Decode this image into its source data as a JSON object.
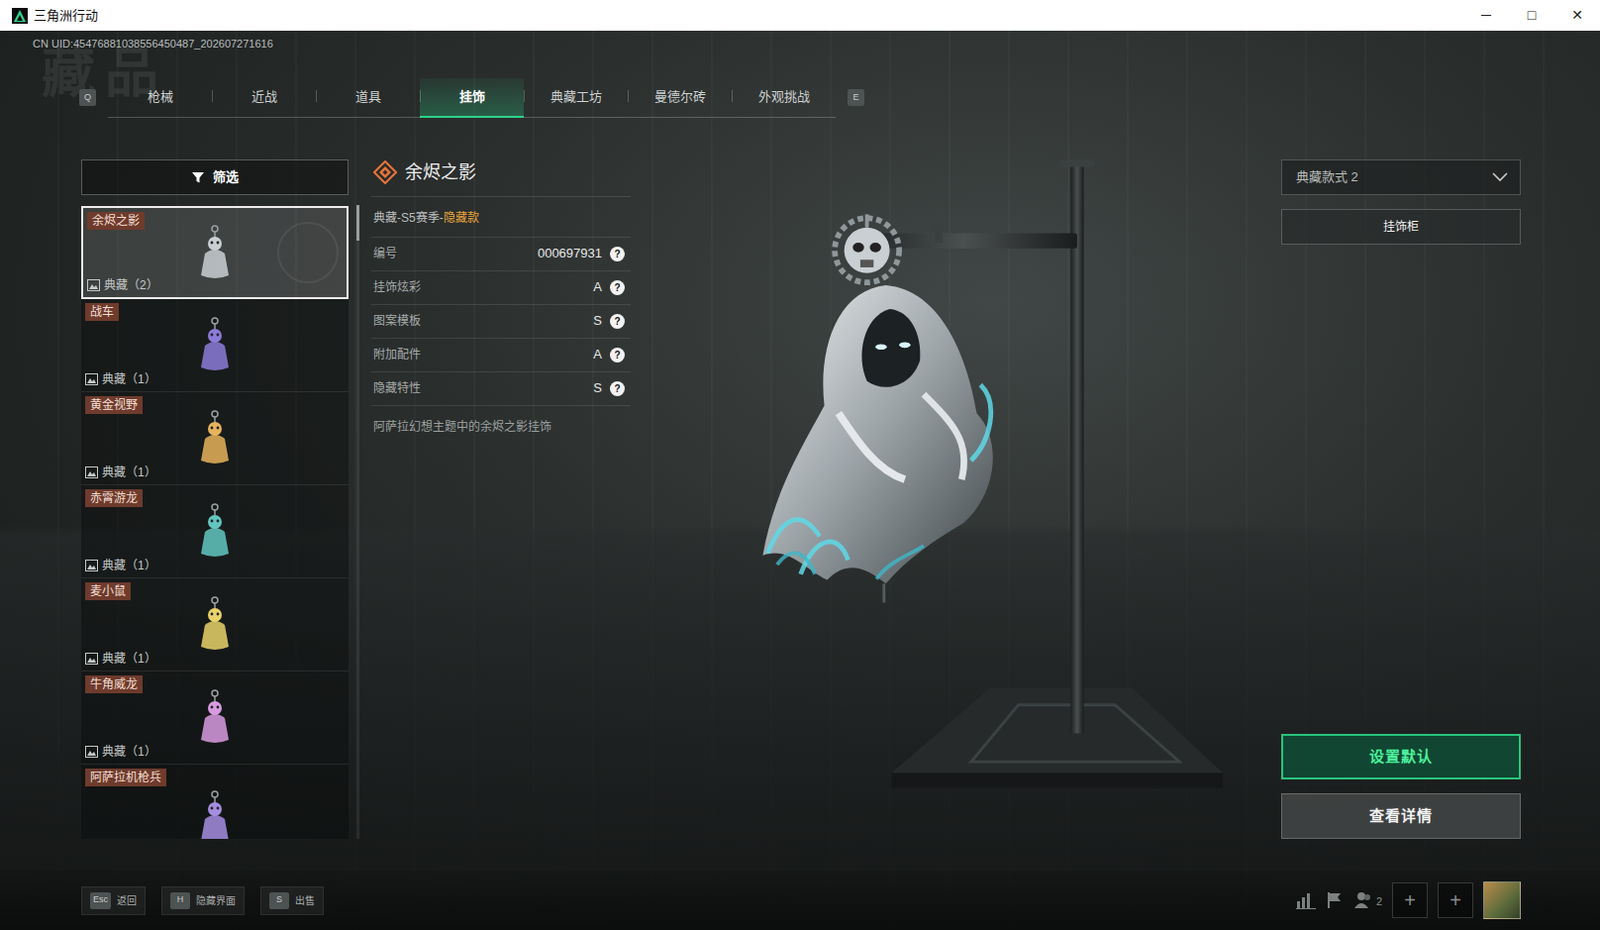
{
  "window": {
    "title": "三角洲行动",
    "controls": [
      "─",
      "□",
      "✕"
    ]
  },
  "uid": "CN UID:45476881038556450487_202607271616",
  "watermark": "藏品",
  "tabs": {
    "prev_key": "Q",
    "next_key": "E",
    "items": [
      {
        "label": "枪械",
        "selected": false
      },
      {
        "label": "近战",
        "selected": false
      },
      {
        "label": "道具",
        "selected": false
      },
      {
        "label": "挂饰",
        "selected": true
      },
      {
        "label": "典藏工坊",
        "selected": false
      },
      {
        "label": "曼德尔砖",
        "selected": false
      },
      {
        "label": "外观挑战",
        "selected": false
      }
    ]
  },
  "filter": {
    "label": "筛选"
  },
  "items": [
    {
      "name": "余烬之影",
      "count": "典藏（2）",
      "selected": true
    },
    {
      "name": "战车",
      "count": "典藏（1）",
      "selected": false
    },
    {
      "name": "黄金视野",
      "count": "典藏（1）",
      "selected": false
    },
    {
      "name": "赤霄游龙",
      "count": "典藏（1）",
      "selected": false
    },
    {
      "name": "麦小鼠",
      "count": "典藏（1）",
      "selected": false
    },
    {
      "name": "牛角威龙",
      "count": "典藏（1）",
      "selected": false
    },
    {
      "name": "阿萨拉机枪兵",
      "selected": false
    }
  ],
  "detail": {
    "title": "余烬之影",
    "tag_prefix": "典藏-S5赛季-",
    "tag_highlight": "隐藏款",
    "attributes": [
      {
        "label": "编号",
        "value": "000697931",
        "help": "?"
      },
      {
        "label": "挂饰炫彩",
        "value": "A",
        "help": "?"
      },
      {
        "label": "图案模板",
        "value": "S",
        "help": "?"
      },
      {
        "label": "附加配件",
        "value": "A",
        "help": "?"
      },
      {
        "label": "隐藏特性",
        "value": "S",
        "help": "?"
      }
    ],
    "description": "阿萨拉幻想主题中的余烬之影挂饰"
  },
  "style_select": {
    "value": "典藏款式 2"
  },
  "cabinet_button": "挂饰柜",
  "actions": [
    {
      "label": "设置默认",
      "kind": "primary"
    },
    {
      "label": "查看详情",
      "kind": "secondary"
    }
  ],
  "hotkeys": [
    {
      "key": "Esc",
      "label": "返回"
    },
    {
      "key": "H",
      "label": "隐藏界面"
    },
    {
      "key": "S",
      "label": "出售"
    }
  ],
  "tray": {
    "squad_count": "2",
    "slots": [
      "+",
      "+"
    ]
  }
}
